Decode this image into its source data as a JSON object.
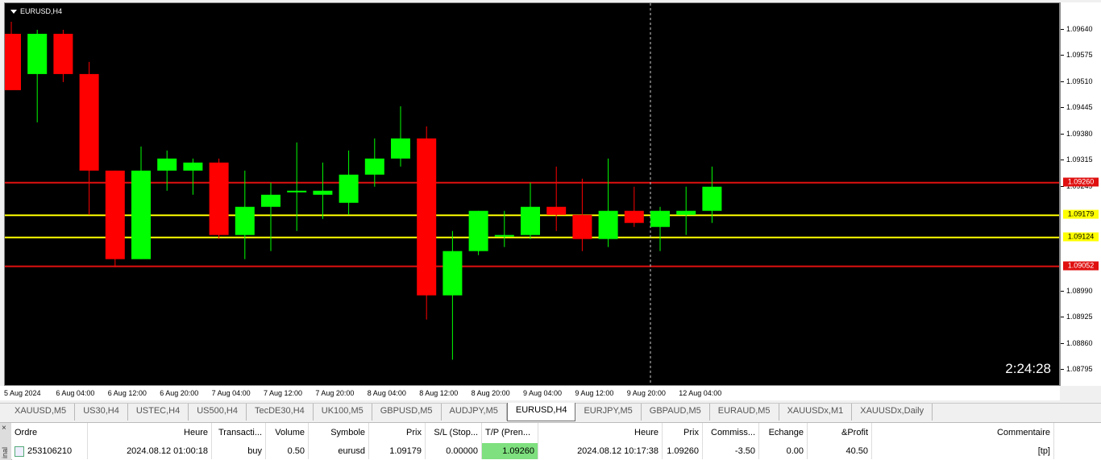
{
  "chart": {
    "symbol_title": "EURUSD,H4",
    "countdown": "2:24:28",
    "y_min": 1.08765,
    "y_max": 1.0969,
    "price_labels": [
      "1.09640",
      "1.09575",
      "1.09510",
      "1.09445",
      "1.09380",
      "1.09315",
      "1.09249",
      "1.08990",
      "1.08925",
      "1.08860",
      "1.08795"
    ],
    "levels": [
      {
        "label": "1.09260",
        "value": 1.0926,
        "line_color": "#e01010",
        "tag_bg": "#e01010",
        "tag_fg": "#ffffff"
      },
      {
        "label": "1.09179",
        "value": 1.09179,
        "line_color": "#ffff00",
        "tag_bg": "#ffff00",
        "tag_fg": "#000000"
      },
      {
        "label": "1.09124",
        "value": 1.09124,
        "line_color": "#ffff00",
        "tag_bg": "#ffff00",
        "tag_fg": "#000000"
      },
      {
        "label": "1.09052",
        "value": 1.09052,
        "line_color": "#e01010",
        "tag_bg": "#e01010",
        "tag_fg": "#ffffff"
      }
    ],
    "bull_color": "#00ff00",
    "bear_color": "#ff0000",
    "candles": [
      {
        "o": 1.0963,
        "h": 1.0966,
        "l": 1.0949,
        "c": 1.0949
      },
      {
        "o": 1.0953,
        "h": 1.0964,
        "l": 1.0941,
        "c": 1.0963
      },
      {
        "o": 1.0963,
        "h": 1.0964,
        "l": 1.0951,
        "c": 1.0953
      },
      {
        "o": 1.0953,
        "h": 1.0956,
        "l": 1.0918,
        "c": 1.0929
      },
      {
        "o": 1.0929,
        "h": 1.0929,
        "l": 1.0905,
        "c": 1.0907
      },
      {
        "o": 1.0907,
        "h": 1.0935,
        "l": 1.0907,
        "c": 1.0929
      },
      {
        "o": 1.0929,
        "h": 1.0934,
        "l": 1.0924,
        "c": 1.0932
      },
      {
        "o": 1.0929,
        "h": 1.0932,
        "l": 1.0923,
        "c": 1.0931
      },
      {
        "o": 1.0931,
        "h": 1.0932,
        "l": 1.0912,
        "c": 1.0913
      },
      {
        "o": 1.0913,
        "h": 1.0929,
        "l": 1.0907,
        "c": 1.092
      },
      {
        "o": 1.092,
        "h": 1.0926,
        "l": 1.0909,
        "c": 1.0923
      },
      {
        "o": 1.0924,
        "h": 1.0936,
        "l": 1.0914,
        "c": 1.0924
      },
      {
        "o": 1.0923,
        "h": 1.0931,
        "l": 1.0917,
        "c": 1.0924
      },
      {
        "o": 1.0921,
        "h": 1.0934,
        "l": 1.0918,
        "c": 1.0928
      },
      {
        "o": 1.0928,
        "h": 1.0937,
        "l": 1.0925,
        "c": 1.0932
      },
      {
        "o": 1.0932,
        "h": 1.0945,
        "l": 1.093,
        "c": 1.0937
      },
      {
        "o": 1.0937,
        "h": 1.094,
        "l": 1.0892,
        "c": 1.0898
      },
      {
        "o": 1.0898,
        "h": 1.0914,
        "l": 1.0882,
        "c": 1.0909
      },
      {
        "o": 1.0909,
        "h": 1.0919,
        "l": 1.0908,
        "c": 1.0919
      },
      {
        "o": 1.0913,
        "h": 1.0919,
        "l": 1.091,
        "c": 1.0913
      },
      {
        "o": 1.0913,
        "h": 1.0926,
        "l": 1.0912,
        "c": 1.092
      },
      {
        "o": 1.092,
        "h": 1.093,
        "l": 1.0914,
        "c": 1.0918
      },
      {
        "o": 1.0918,
        "h": 1.0927,
        "l": 1.0909,
        "c": 1.0912
      },
      {
        "o": 1.0912,
        "h": 1.0932,
        "l": 1.091,
        "c": 1.0919
      },
      {
        "o": 1.0919,
        "h": 1.0925,
        "l": 1.0915,
        "c": 1.0916
      },
      {
        "o": 1.0915,
        "h": 1.092,
        "l": 1.0909,
        "c": 1.0919
      },
      {
        "o": 1.0918,
        "h": 1.0925,
        "l": 1.0913,
        "c": 1.0919
      },
      {
        "o": 1.0919,
        "h": 1.093,
        "l": 1.0916,
        "c": 1.0925
      }
    ],
    "time_labels": [
      "5 Aug 2024",
      "6 Aug 04:00",
      "6 Aug 12:00",
      "6 Aug 20:00",
      "7 Aug 04:00",
      "7 Aug 12:00",
      "7 Aug 20:00",
      "8 Aug 04:00",
      "8 Aug 12:00",
      "8 Aug 20:00",
      "9 Aug 04:00",
      "9 Aug 12:00",
      "9 Aug 20:00",
      "12 Aug 04:00"
    ]
  },
  "tabs": {
    "active": "EURUSD,H4",
    "items": [
      "XAUUSD,M5",
      "US30,H4",
      "USTEC,H4",
      "US500,H4",
      "TecDE30,H4",
      "UK100,M5",
      "GBPUSD,M5",
      "AUDJPY,M5",
      "EURUSD,H4",
      "EURJPY,M5",
      "GBPAUD,M5",
      "EURAUD,M5",
      "XAUUSDx,M1",
      "XAUUSDx,Daily"
    ]
  },
  "terminal": {
    "side_label": "inal",
    "close_glyph": "×",
    "headers": [
      "Ordre",
      "Heure",
      "Transacti...",
      "Volume",
      "Symbole",
      "Prix",
      "S/L (Stop...",
      "T/P (Pren...",
      "Heure",
      "Prix",
      "Commiss...",
      "Echange",
      "&Profit",
      "Commentaire"
    ],
    "row": [
      "253106210",
      "2024.08.12 01:00:18",
      "buy",
      "0.50",
      "eurusd",
      "1.09179",
      "0.00000",
      "1.09260",
      "2024.08.12 10:17:38",
      "1.09260",
      "-3.50",
      "0.00",
      "40.50",
      "[tp]"
    ]
  }
}
